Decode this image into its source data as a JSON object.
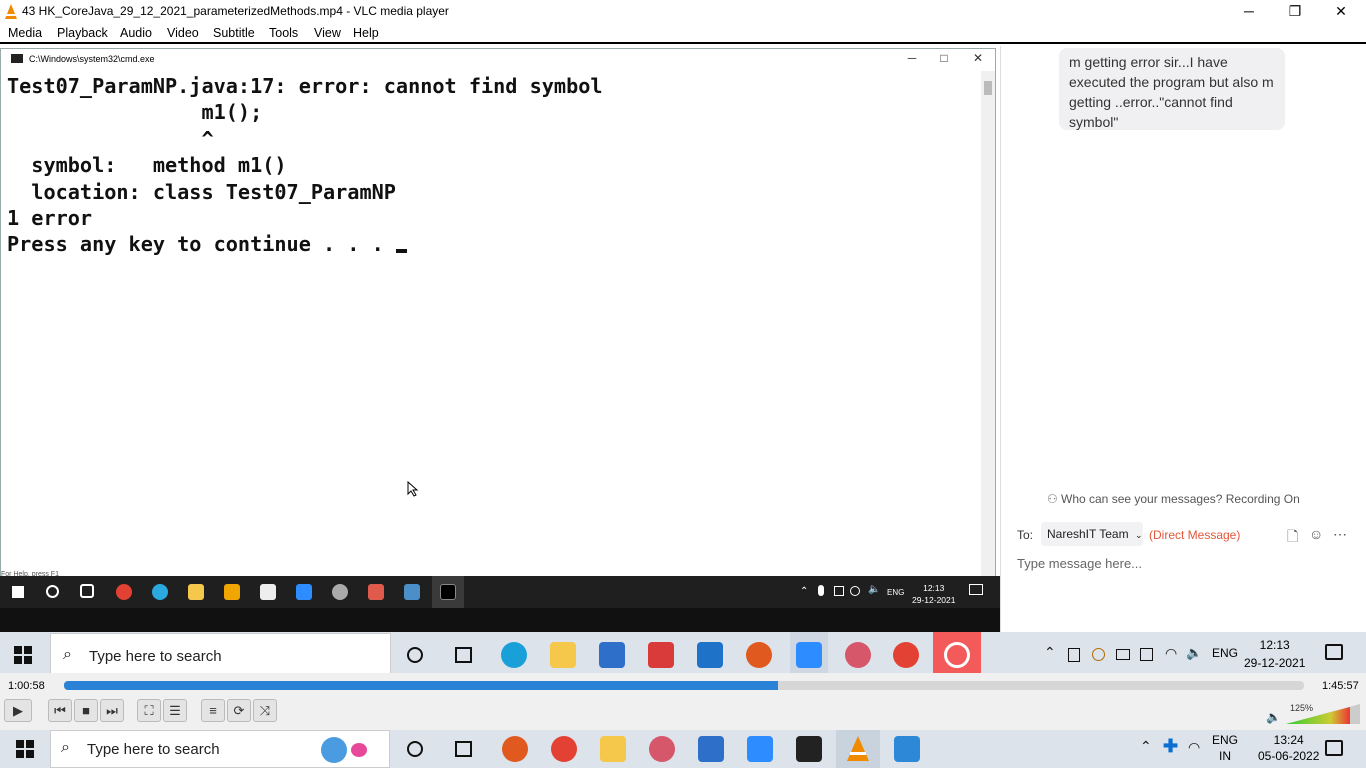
{
  "window": {
    "title": "43 HK_CoreJava_29_12_2021_parameterizedMethods.mp4 - VLC media player",
    "minimize": "─",
    "maximize": "❐",
    "close": "✕"
  },
  "menu": [
    "Media",
    "Playback",
    "Audio",
    "Video",
    "Subtitle",
    "Tools",
    "View",
    "Help"
  ],
  "cmd": {
    "title": "C:\\Windows\\system32\\cmd.exe",
    "lines": [
      "Test07_ParamNP.java:17: error: cannot find symbol",
      "                m1();",
      "                ^",
      "  symbol:   method m1()",
      "  location: class Test07_ParamNP",
      "1 error",
      "Press any key to continue . . . "
    ],
    "status": "For Help, press F1"
  },
  "inner_taskbar": {
    "lang": "ENG",
    "time": "12:13",
    "date": "29-12-2021"
  },
  "chat": {
    "message": "m getting error sir...I have executed the program but also m getting ..error..\"cannot find symbol\"",
    "privacy": "Who can see your messages? Recording On",
    "to_label": "To:",
    "recipient": "NareshIT Team",
    "direct": "(Direct Message)",
    "input_placeholder": "Type message here..."
  },
  "recorded_taskbar": {
    "search_placeholder": "Type here to search",
    "lang": "ENG",
    "time": "12:13",
    "date": "29-12-2021"
  },
  "player": {
    "elapsed": "1:00:58",
    "total": "1:45:57",
    "progress": 0.576,
    "volume": "125%"
  },
  "taskbar": {
    "search_placeholder": "Type here to search",
    "lang": "ENG",
    "region": "IN",
    "time": "13:24",
    "date": "05-06-2022"
  }
}
